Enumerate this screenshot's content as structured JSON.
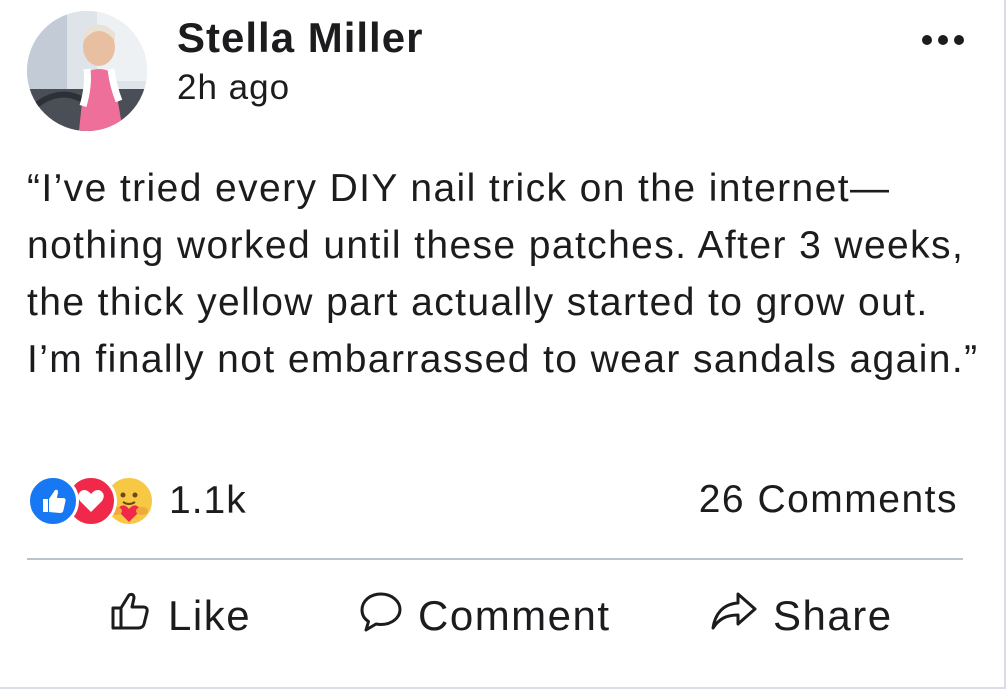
{
  "post": {
    "author": "Stella Miller",
    "time": "2h ago",
    "text": "“I’ve tried every DIY nail trick on the internet—nothing worked until these patches. After 3 weeks, the thick yellow part actually started to grow out. I’m finally not embarrassed to wear sandals again.”"
  },
  "stats": {
    "reactions": [
      "like-icon",
      "love-icon",
      "care-icon"
    ],
    "reaction_count": "1.1k",
    "comments": "26 Comments"
  },
  "actions": {
    "like": "Like",
    "comment": "Comment",
    "share": "Share"
  },
  "colors": {
    "like_blue": "#1877f2",
    "love_red": "#f02849",
    "care_yellow": "#f7c844",
    "divider": "#b9c4d1"
  }
}
